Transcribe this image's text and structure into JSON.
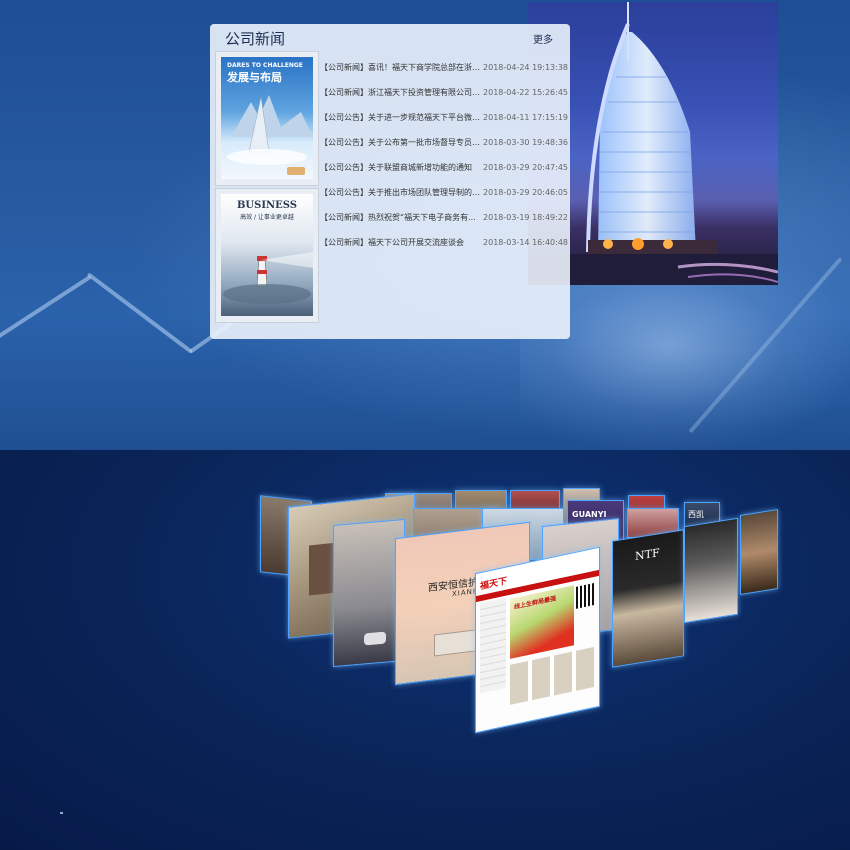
{
  "news": {
    "title": "公司新闻",
    "more_label": "更多",
    "thumb1": {
      "line1": "DARES TO CHALLENGE",
      "line2": "发展与布局"
    },
    "thumb2": {
      "line1": "BUSINESS",
      "line2": "高效 / 让事业更卓越"
    },
    "items": [
      {
        "title": "【公司新闻】喜讯！福天下商学院总部在浙江省...",
        "date": "2018-04-24 19:13:38"
      },
      {
        "title": "【公司新闻】浙江福天下投资管理有限公司在杭...",
        "date": "2018-04-22 15:26:45"
      },
      {
        "title": "【公司公告】关于进一步规范福天下平台微信群...",
        "date": "2018-04-11 17:15:19"
      },
      {
        "title": "【公司公告】关于公布第一批市场督导专员聘用...",
        "date": "2018-03-30 19:48:36"
      },
      {
        "title": "【公司公告】关于联盟商城新增功能的通知",
        "date": "2018-03-29 20:47:45"
      },
      {
        "title": "【公司公告】关于推出市场团队管理导制的通...",
        "date": "2018-03-29 20:46:05"
      },
      {
        "title": "【公司新闻】热烈祝贺“福天下电子商务有...",
        "date": "2018-03-19 18:49:22"
      },
      {
        "title": "【公司新闻】福天下公司开展交流座谈会",
        "date": "2018-03-14 16:40:48"
      }
    ]
  },
  "gallery": {
    "card_office_text": "西安恒信护",
    "card_office_sub": "XIANHE",
    "card_ntf_text": "NTF",
    "card_site_logo": "福天下",
    "card_site_banner": "线上生鲜局最强",
    "card_brand_text": "GUANYI",
    "card_shop_text": "西凯"
  }
}
